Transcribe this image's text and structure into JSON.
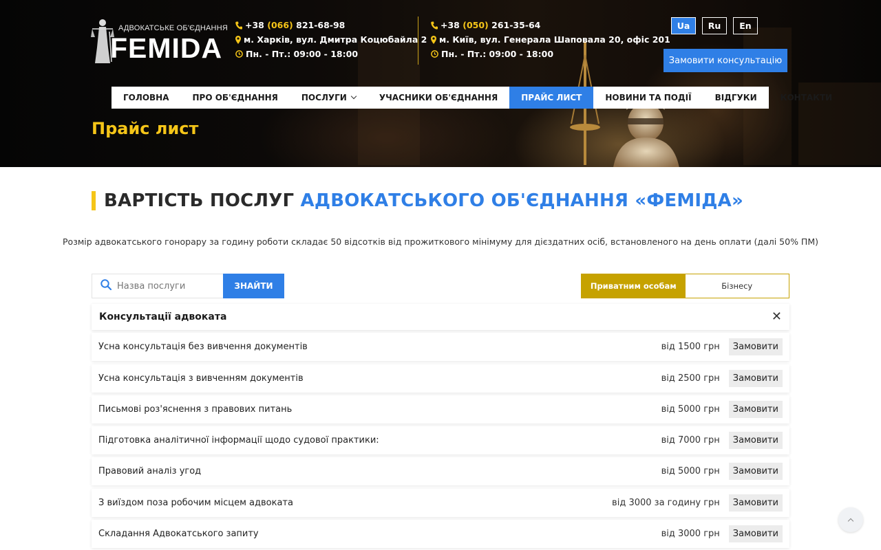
{
  "brand": {
    "subtitle": "АДВОКАТСЬКЕ ОБ'ЄДНАННЯ",
    "name": "FEMIDA"
  },
  "contacts": [
    {
      "phone_prefix": "+38",
      "phone_code": "(066)",
      "phone_number": "821-68-98",
      "address": "м. Харків, вул. Дмитра Коцюбайла 2",
      "hours": "Пн. - Пт.: 09:00 - 18:00"
    },
    {
      "phone_prefix": "+38",
      "phone_code": "(050)",
      "phone_number": "261-35-64",
      "address": "м. Київ, вул. Генерала Шаповала 20, офіс 201",
      "hours": "Пн. - Пт.: 09:00 - 18:00"
    }
  ],
  "languages": [
    {
      "label": "Ua",
      "active": true
    },
    {
      "label": "Ru",
      "active": false
    },
    {
      "label": "En",
      "active": false
    }
  ],
  "cta_label": "Замовити консультацію",
  "nav": [
    {
      "label": "ГОЛОВНА"
    },
    {
      "label": "ПРО ОБ'ЄДНАННЯ"
    },
    {
      "label": "ПОСЛУГИ"
    },
    {
      "label": "УЧАСНИКИ ОБ'ЄДНАННЯ"
    },
    {
      "label": "ПРАЙС ЛИСТ"
    },
    {
      "label": "НОВИНИ ТА ПОДІЇ"
    },
    {
      "label": "ВІДГУКИ"
    },
    {
      "label": "КОНТАКТИ"
    }
  ],
  "page_title": "Прайс лист",
  "heading": {
    "part1": "ВАРТІСТЬ ПОСЛУГ",
    "part2": "АДВОКАТСЬКОГО ОБ'ЄДНАННЯ «ФЕМІДА»"
  },
  "description": "Розмір адвокатського гонорару за годину роботи складає 50 відсотків від прожиткового мінімуму для дієздатних осіб, встановленого на день оплати (далі 50% ПМ)",
  "search": {
    "placeholder": "Назва послуги",
    "button": "ЗНАЙТИ"
  },
  "tabs": [
    {
      "label": "Приватним особам",
      "active": true
    },
    {
      "label": "Бізнесу",
      "active": false
    }
  ],
  "panel": {
    "title": "Консультації адвоката",
    "close": "✕",
    "order_label": "Замовити",
    "items": [
      {
        "name": "Усна консультація без вивчення документів",
        "price": "від 1500 грн"
      },
      {
        "name": "Усна консультація з вивченням документів",
        "price": "від 2500 грн"
      },
      {
        "name": "Письмові роз'яснення з правових питань",
        "price": "від 5000 грн"
      },
      {
        "name": "Підготовка аналітичної інформації щодо судової практики:",
        "price": "від 7000 грн"
      },
      {
        "name": "Правовий аналіз угод",
        "price": "від 5000 грн"
      },
      {
        "name": "З виїздом поза робочим місцем адвоката",
        "price": "від 3000 за годину грн"
      },
      {
        "name": "Складання Адвокатського запиту",
        "price": "від 3000 грн"
      }
    ]
  },
  "colors": {
    "accent_blue": "#2f7fe6",
    "accent_yellow": "#f5c518",
    "tab_gold": "#c6a200"
  },
  "icons": [
    "phone-icon",
    "map-pin-icon",
    "clock-icon",
    "search-icon",
    "close-icon",
    "chevron-down-icon",
    "chevron-up-icon"
  ]
}
